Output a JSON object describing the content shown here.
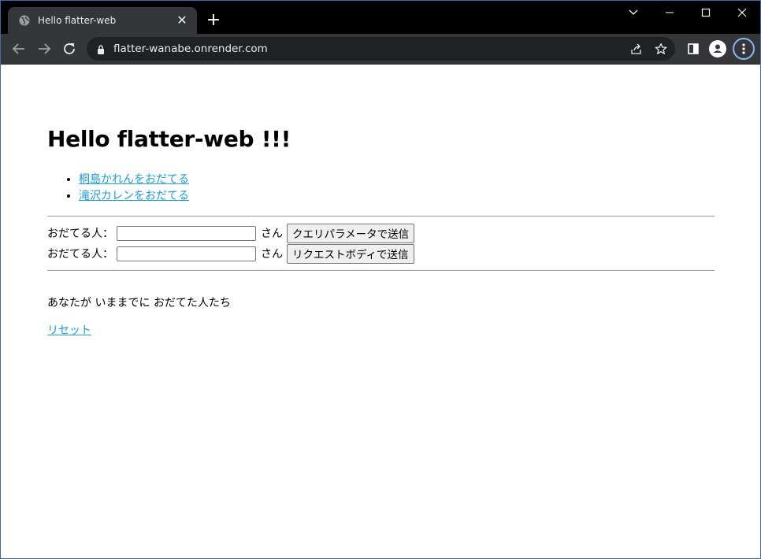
{
  "browser": {
    "tab_title": "Hello flatter-web",
    "url": "flatter-wanabe.onrender.com"
  },
  "page": {
    "heading": "Hello flatter-web !!!",
    "links": [
      {
        "label": "桐島かれんをおだてる"
      },
      {
        "label": "滝沢カレンをおだてる"
      }
    ],
    "form_query": {
      "label": "おだてる人：",
      "value": "",
      "suffix": "さん",
      "button": "クエリパラメータで送信"
    },
    "form_body": {
      "label": "おだてる人：",
      "value": "",
      "suffix": "さん",
      "button": "リクエストボディで送信"
    },
    "history_title": "あなたが いままでに おだてた人たち",
    "reset_label": "リセット"
  }
}
